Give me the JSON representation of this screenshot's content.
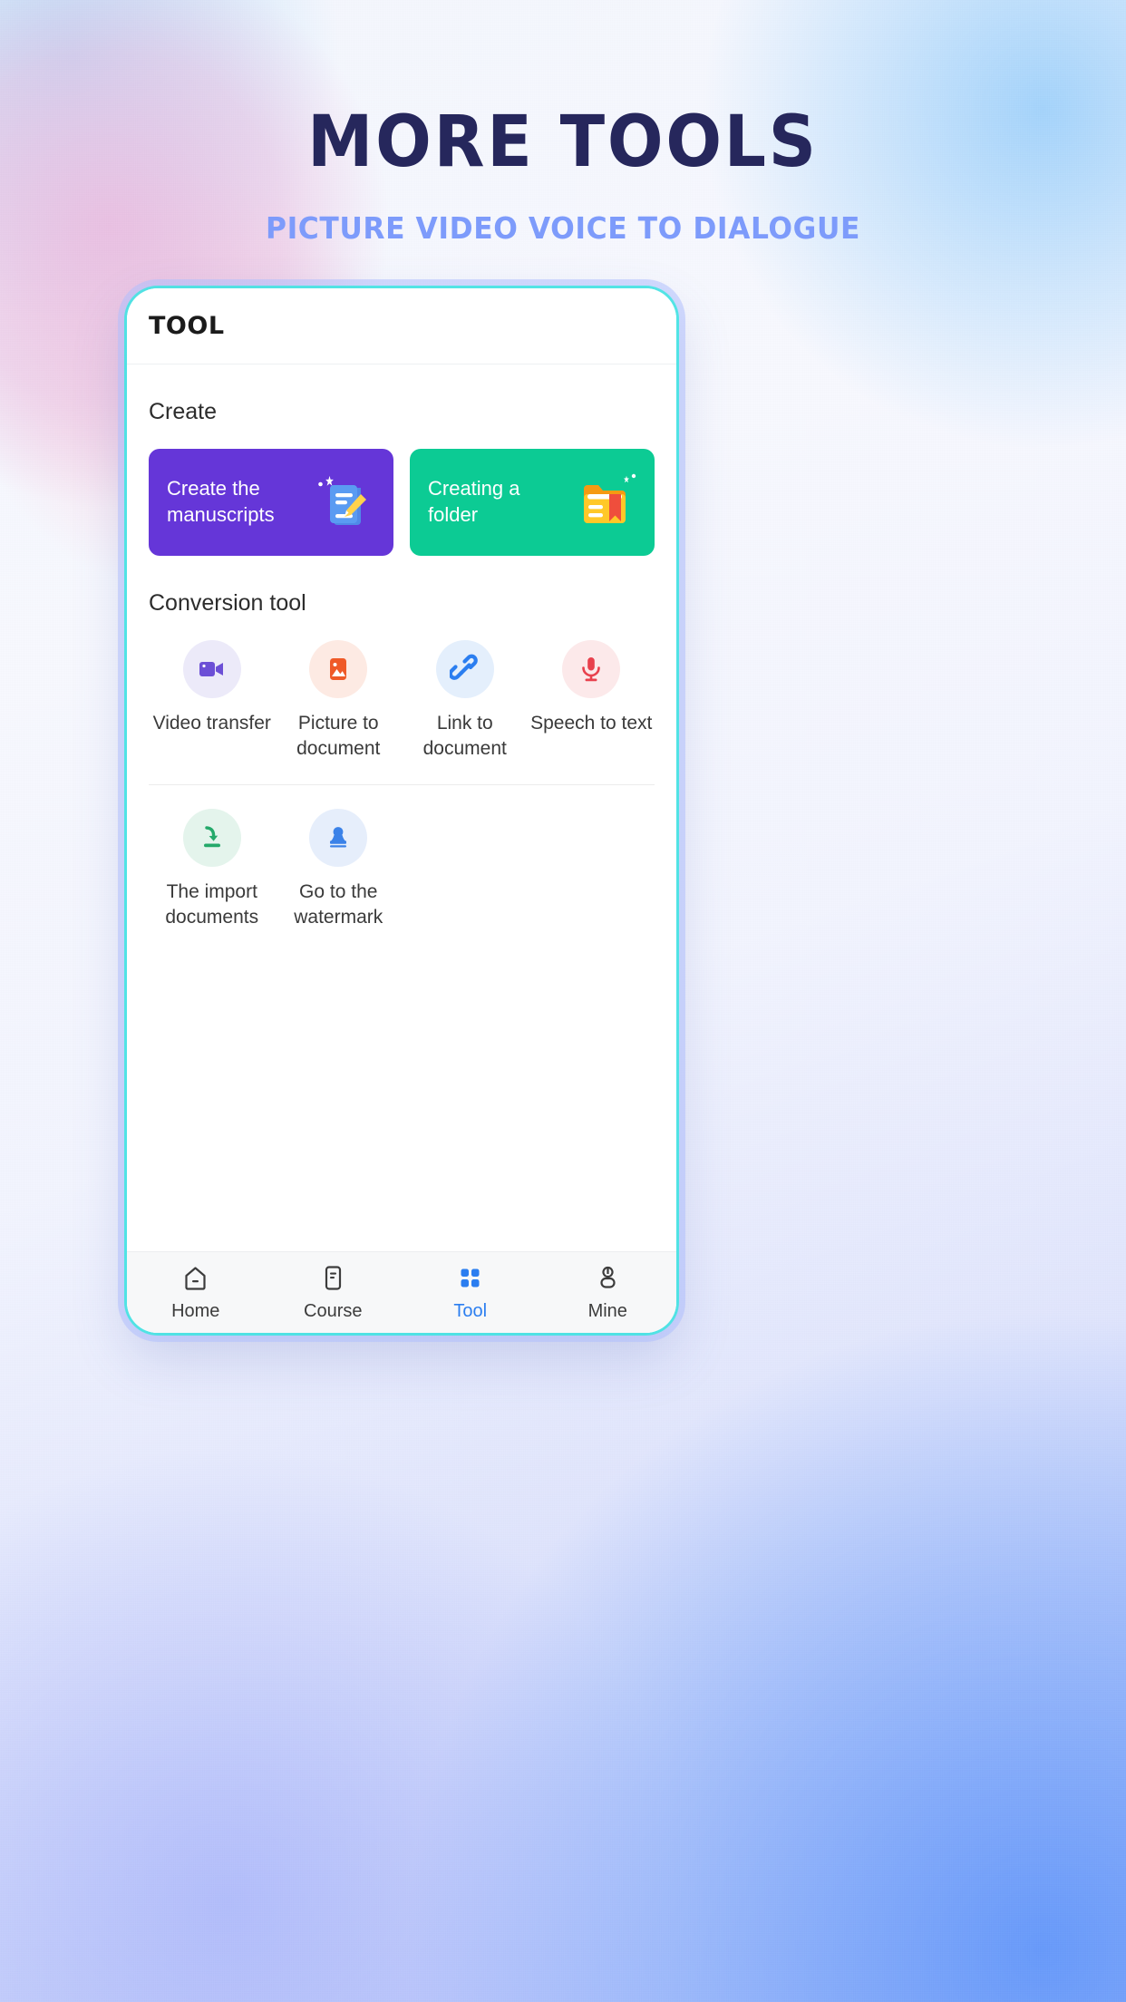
{
  "banner": {
    "headline": "MORE TOOLS",
    "subheadline": "PICTURE VIDEO VOICE TO DIALOGUE",
    "headline_color": "#26275c",
    "subheadline_color": "#7d9bfb"
  },
  "app": {
    "header_title": "TOOL",
    "sections": {
      "create_title": "Create",
      "conversion_title": "Conversion tool"
    },
    "create_cards": [
      {
        "label": "Create the manuscripts",
        "icon": "document-pencil-icon",
        "bg_color": "#6536d8"
      },
      {
        "label": "Creating a folder",
        "icon": "folder-bookmark-icon",
        "bg_color": "#0ccb94"
      }
    ],
    "conversion_tools_row1": [
      {
        "label": "Video transfer",
        "icon": "video-camera-icon",
        "icon_color": "#6c4fd6",
        "circle_color": "#eceaf9"
      },
      {
        "label": "Picture to document",
        "icon": "image-icon",
        "icon_color": "#ef5a28",
        "circle_color": "#fdeae3"
      },
      {
        "label": "Link to document",
        "icon": "link-icon",
        "icon_color": "#2b7ef0",
        "circle_color": "#e4effc"
      },
      {
        "label": "Speech to text",
        "icon": "microphone-icon",
        "icon_color": "#e8414d",
        "circle_color": "#fce9ea"
      }
    ],
    "conversion_tools_row2": [
      {
        "label": "The import documents",
        "icon": "download-icon",
        "icon_color": "#24a96a",
        "circle_color": "#e4f4ec"
      },
      {
        "label": "Go to the watermark",
        "icon": "stamp-icon",
        "icon_color": "#3b82e8",
        "circle_color": "#e6eefb"
      }
    ],
    "tabs": [
      {
        "label": "Home",
        "icon": "home-icon",
        "active": false
      },
      {
        "label": "Course",
        "icon": "course-icon",
        "active": false
      },
      {
        "label": "Tool",
        "icon": "grid-icon",
        "active": true
      },
      {
        "label": "Mine",
        "icon": "person-icon",
        "active": false
      }
    ],
    "active_tab_color": "#2b7ef0"
  }
}
